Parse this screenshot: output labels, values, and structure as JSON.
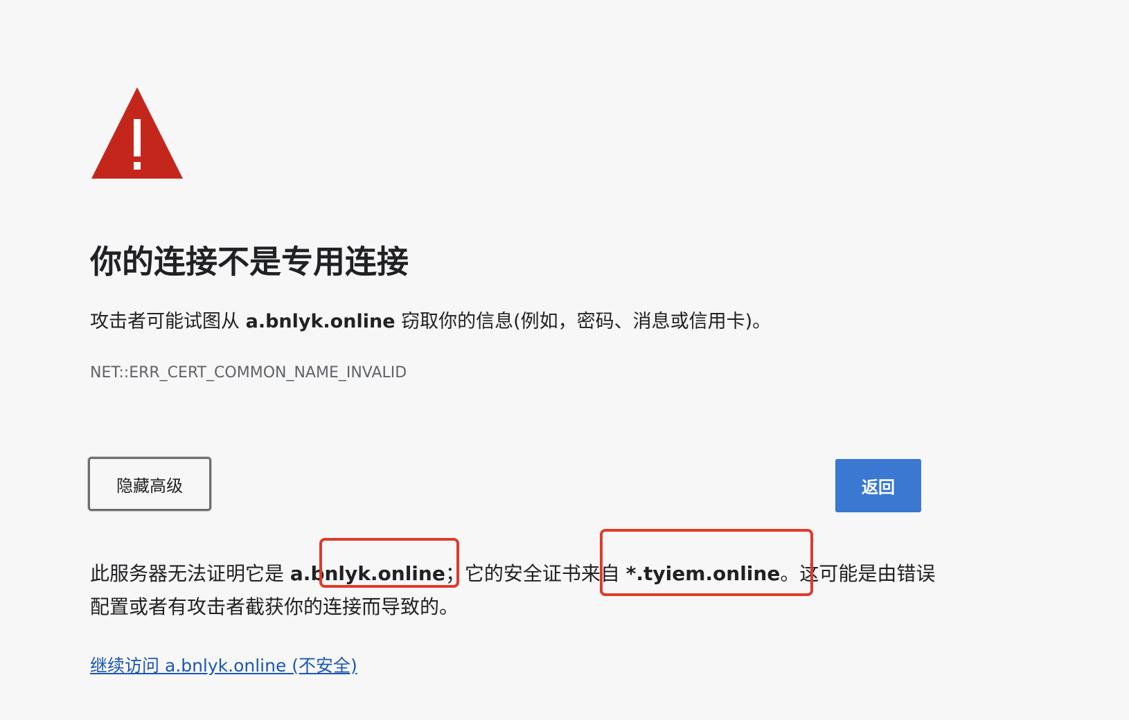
{
  "page": {
    "icon": "warning-triangle-icon",
    "title": "你的连接不是专用连接",
    "description": {
      "prefix": "攻击者可能试图从 ",
      "host": "a.bnlyk.online",
      "suffix": " 窃取你的信息(例如，密码、消息或信用卡)。"
    },
    "error_code": "NET::ERR_CERT_COMMON_NAME_INVALID",
    "buttons": {
      "hide_advanced": "隐藏高级",
      "back": "返回"
    },
    "details": {
      "part1": "此服务器无法证明它是 ",
      "host": "a.bnlyk.online",
      "part2": "；它的安全证书来自 ",
      "cert_host": "*.tyiem.online",
      "part3": "。这可能是由错误配置或者有攻击者截获你的连接而导致的。"
    },
    "proceed_link": "继续访问 a.bnlyk.online (不安全)"
  },
  "colors": {
    "background": "#f7f7f7",
    "warning_red": "#c5261c",
    "primary_blue": "#3a78d1",
    "link_blue": "#1a57b3",
    "annotation_red": "#e03a2a"
  }
}
